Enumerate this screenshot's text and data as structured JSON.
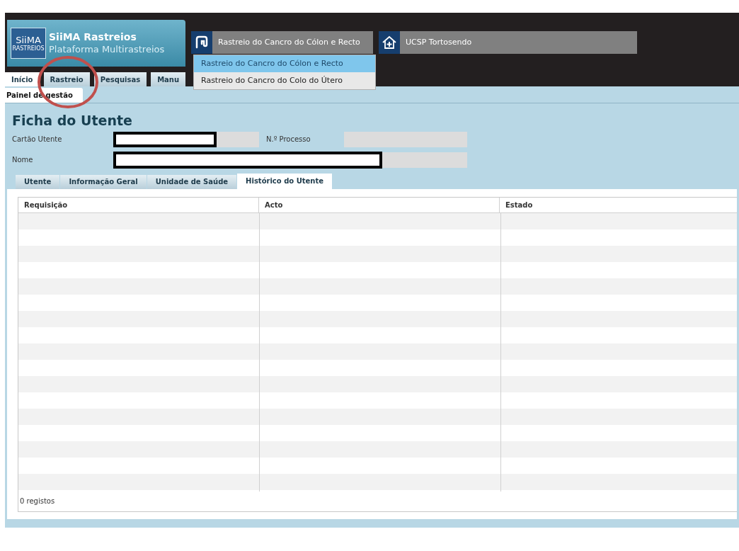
{
  "logo": {
    "mark": "SiiMA",
    "mark_sub": "RASTREIOS",
    "title": "SiiMA Rastreios",
    "subtitle": "Plataforma Multirastreios"
  },
  "program_selector": {
    "label": "Rastreio do Cancro do Cólon e Recto",
    "expanded": true,
    "options": [
      {
        "label": "Rastreio do Cancro do Cólon e Recto",
        "selected": true
      },
      {
        "label": "Rastreio do Cancro do Colo do Útero",
        "selected": false
      }
    ]
  },
  "unit_selector": {
    "label": "UCSP Tortosendo"
  },
  "nav_tabs": [
    {
      "label": "Início",
      "selected": true
    },
    {
      "label": "Rastreio",
      "selected": false
    },
    {
      "label": "Pesquisas",
      "selected": false
    },
    {
      "label": "Manu",
      "selected": false
    }
  ],
  "sub_tabs": [
    {
      "label": "Painel de gestão",
      "selected": true
    }
  ],
  "page_title": "Ficha do Utente",
  "fields": [
    {
      "label": "Cartão Utente"
    },
    {
      "label": "N.º Processo"
    },
    {
      "label": "Nome"
    }
  ],
  "detail_tabs": [
    {
      "label": "Utente",
      "selected": false
    },
    {
      "label": "Informação Geral",
      "selected": false
    },
    {
      "label": "Unidade de Saúde",
      "selected": false
    },
    {
      "label": "Histórico do Utente",
      "selected": true
    }
  ],
  "table": {
    "columns": [
      "Requisição",
      "Acto",
      "Estado"
    ],
    "footer": "0 registos"
  }
}
